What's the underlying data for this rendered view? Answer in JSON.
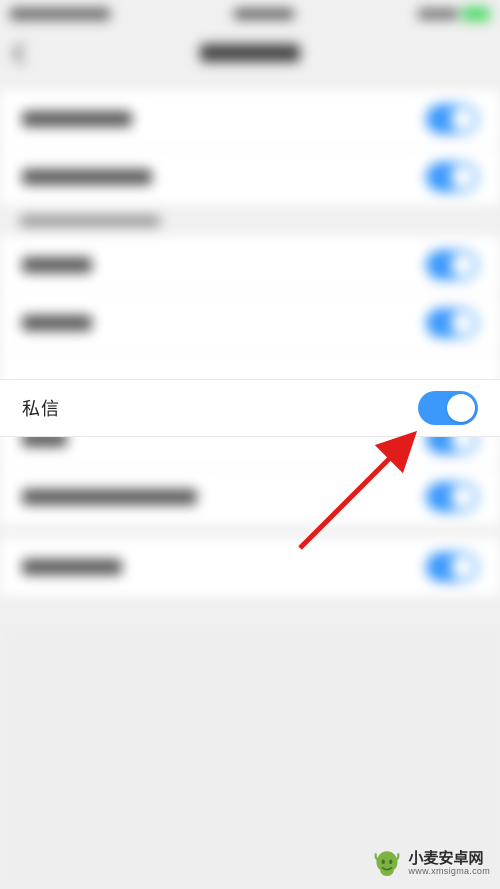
{
  "focus_row": {
    "label": "私信",
    "toggle_on": true
  },
  "toggle_color": "#3b99fc",
  "arrow_color": "#e21b1b",
  "watermark": {
    "brand": "小麦安卓网",
    "url": "www.xmsigma.com"
  }
}
